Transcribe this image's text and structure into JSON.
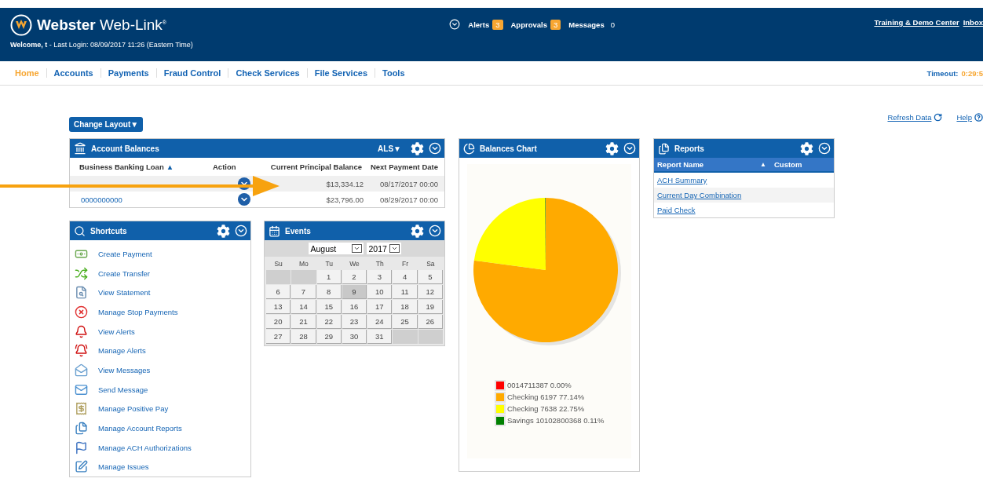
{
  "header": {
    "brand_bold": "Webster",
    "brand_light": "Web-Link",
    "brand_mark": "®",
    "welcome": "Welcome, t",
    "last_login": " - Last Login: 08/09/2017 11:26 (Eastern Time)",
    "notices": [
      {
        "label": "Alerts",
        "count": "3",
        "highlight": true
      },
      {
        "label": "Approvals",
        "count": "3",
        "highlight": true
      },
      {
        "label": "Messages",
        "count": "0",
        "highlight": false
      }
    ],
    "links": [
      "Training & Demo Center",
      "Inbox"
    ]
  },
  "nav": {
    "items": [
      {
        "label": "Home",
        "selected": true
      },
      {
        "label": "Accounts",
        "selected": false
      },
      {
        "label": "Payments",
        "selected": false
      },
      {
        "label": "Fraud Control",
        "selected": false
      },
      {
        "label": "Check Services",
        "selected": false
      },
      {
        "label": "File Services",
        "selected": false
      },
      {
        "label": "Tools",
        "selected": false
      }
    ],
    "timeout_label": "Timeout:",
    "timeout_value": "0:29:5"
  },
  "toolbar": {
    "refresh": "Refresh Data",
    "help": "Help",
    "change_layout": "Change Layout▼"
  },
  "account_balances": {
    "title": "Account Balances",
    "filter": "ALS▼",
    "columns": [
      "Business Banking Loan",
      "Action",
      "Current Principal Balance",
      "Next Payment Date"
    ],
    "sort_mark": "▲",
    "rows": [
      {
        "balance": "$13,334.12",
        "date": "08/17/2017 00:00"
      },
      {
        "account": "0000000000",
        "balance": "$23,796.00",
        "date": "08/29/2017 00:00"
      }
    ]
  },
  "shortcuts": {
    "title": "Shortcuts",
    "items": [
      "Create Payment",
      "Create Transfer",
      "View Statement",
      "Manage Stop Payments",
      "View Alerts",
      "Manage Alerts",
      "View Messages",
      "Send Message",
      "Manage Positive Pay",
      "Manage Account Reports",
      "Manage ACH Authorizations",
      "Manage Issues"
    ]
  },
  "events": {
    "title": "Events",
    "month": "August",
    "year": "2017",
    "weekdays": [
      "Su",
      "Mo",
      "Tu",
      "We",
      "Th",
      "Fr",
      "Sa"
    ],
    "weeks": [
      [
        {
          "kind": "blank"
        },
        {
          "kind": "blank"
        },
        {
          "kind": "day",
          "day": "1",
          "selected": false
        },
        {
          "kind": "day",
          "day": "2",
          "selected": false
        },
        {
          "kind": "day",
          "day": "3",
          "selected": false
        },
        {
          "kind": "day",
          "day": "4",
          "selected": false
        },
        {
          "kind": "day",
          "day": "5",
          "selected": false
        }
      ],
      [
        {
          "kind": "day",
          "day": "6",
          "selected": false
        },
        {
          "kind": "day",
          "day": "7",
          "selected": false
        },
        {
          "kind": "day",
          "day": "8",
          "selected": false
        },
        {
          "kind": "day",
          "day": "9",
          "selected": true
        },
        {
          "kind": "day",
          "day": "10",
          "selected": false
        },
        {
          "kind": "day",
          "day": "11",
          "selected": false
        },
        {
          "kind": "day",
          "day": "12",
          "selected": false
        }
      ],
      [
        {
          "kind": "day",
          "day": "13",
          "selected": false
        },
        {
          "kind": "day",
          "day": "14",
          "selected": false
        },
        {
          "kind": "day",
          "day": "15",
          "selected": false
        },
        {
          "kind": "day",
          "day": "16",
          "selected": false
        },
        {
          "kind": "day",
          "day": "17",
          "selected": false
        },
        {
          "kind": "day",
          "day": "18",
          "selected": false
        },
        {
          "kind": "day",
          "day": "19",
          "selected": false
        }
      ],
      [
        {
          "kind": "day",
          "day": "20",
          "selected": false
        },
        {
          "kind": "day",
          "day": "21",
          "selected": false
        },
        {
          "kind": "day",
          "day": "22",
          "selected": false
        },
        {
          "kind": "day",
          "day": "23",
          "selected": false
        },
        {
          "kind": "day",
          "day": "24",
          "selected": false
        },
        {
          "kind": "day",
          "day": "25",
          "selected": false
        },
        {
          "kind": "day",
          "day": "26",
          "selected": false
        }
      ],
      [
        {
          "kind": "day",
          "day": "27",
          "selected": false
        },
        {
          "kind": "day",
          "day": "28",
          "selected": false
        },
        {
          "kind": "day",
          "day": "29",
          "selected": false
        },
        {
          "kind": "day",
          "day": "30",
          "selected": false
        },
        {
          "kind": "day",
          "day": "31",
          "selected": false
        },
        {
          "kind": "blank"
        },
        {
          "kind": "blank"
        }
      ]
    ]
  },
  "balances_chart": {
    "title": "Balances Chart",
    "chart_data": {
      "type": "pie",
      "categories": [
        "0014711387",
        "Checking 6197",
        "Checking 7638",
        "Savings 10102800368"
      ],
      "value_labels": [
        "0.00%",
        "77.14%",
        "22.75%",
        "0.11%"
      ],
      "series": [
        {
          "values": [
            0.0,
            77.14,
            22.75,
            0.11
          ]
        }
      ],
      "colors": [
        "#ff0000",
        "#ffaa00",
        "#ffff00",
        "#008000"
      ]
    }
  },
  "reports": {
    "title": "Reports",
    "columns": [
      "Report Name",
      "Custom"
    ],
    "sort_mark": "▲",
    "rows": [
      "ACH Summary",
      "Current Day Combination",
      "Paid Check"
    ]
  }
}
